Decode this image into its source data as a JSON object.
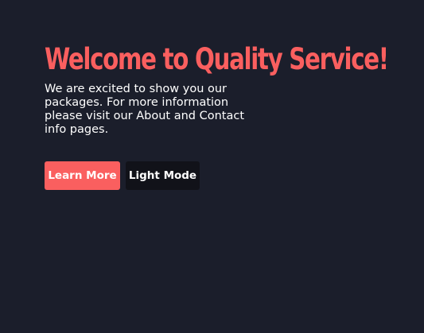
{
  "hero": {
    "title": "Welcome to Quality Service!",
    "text": "We are excited to show you our packages. For more information please visit our About and Contact info pages."
  },
  "actions": {
    "learn_more_label": "Learn More",
    "light_mode_label": "Light Mode"
  },
  "colors": {
    "background": "#1b1e2b",
    "accent": "#fa5f5f",
    "dark_button": "#111219",
    "text": "#ffffff"
  }
}
